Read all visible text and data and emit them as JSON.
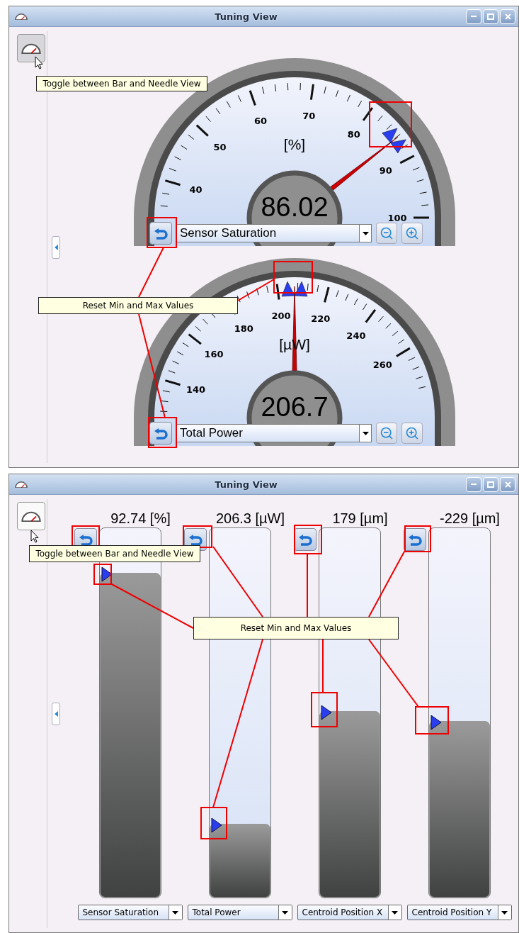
{
  "windows": [
    {
      "title": "Tuning View",
      "tooltips": [
        {
          "kind": "toggle",
          "text": "Toggle between Bar and Needle View"
        },
        {
          "kind": "reset",
          "text": "Reset Min and Max Values"
        }
      ],
      "gauges": [
        {
          "unit": "[%]",
          "value": "86.02",
          "level": 0.789,
          "scale": [
            "40",
            "50",
            "60",
            "70",
            "80",
            "90",
            "100"
          ],
          "channel": "Sensor Saturation"
        },
        {
          "unit": "[µW]",
          "value": "206.7",
          "level": 0.5,
          "scale": [
            "140",
            "160",
            "180",
            "200",
            "220",
            "240",
            "260"
          ],
          "channel": "Total Power"
        }
      ]
    },
    {
      "title": "Tuning View",
      "tooltips": [
        {
          "kind": "toggle",
          "text": "Toggle between Bar and Needle View"
        },
        {
          "kind": "reset",
          "text": "Reset Min and Max Values"
        }
      ],
      "bars": [
        {
          "reading": "92.74 [%]",
          "level": 0.88,
          "channel": "Sensor Saturation"
        },
        {
          "reading": "206.3 [µW]",
          "level": 0.2,
          "channel": "Total Power"
        },
        {
          "reading": "179 [µm]",
          "level": 0.505,
          "channel": "Centroid Position X"
        },
        {
          "reading": "-229 [µm]",
          "level": 0.478,
          "channel": "Centroid Position Y"
        }
      ]
    }
  ]
}
